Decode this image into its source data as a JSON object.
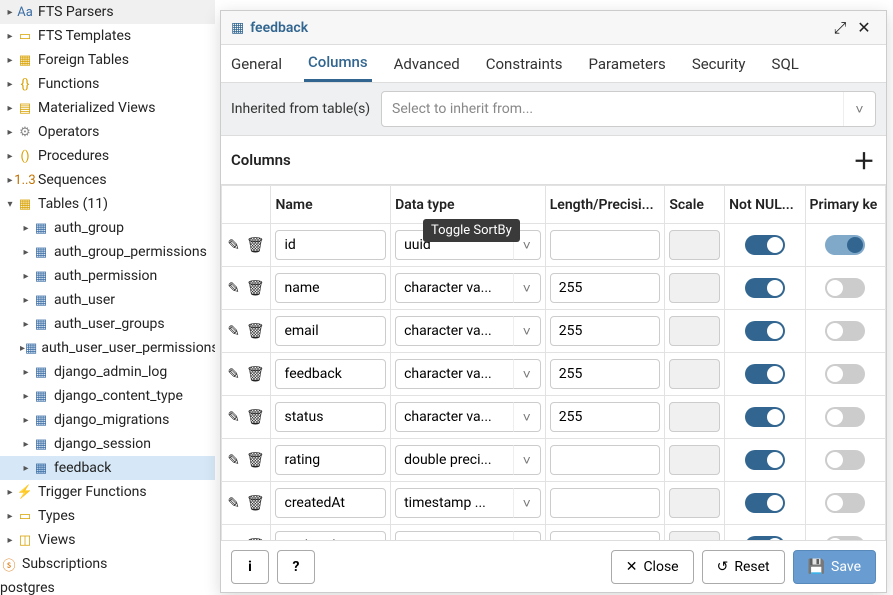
{
  "sidebar": {
    "top_items": [
      {
        "icon": "Aa",
        "label": "FTS Parsers",
        "color": "#3b6ea5"
      },
      {
        "icon": "▭",
        "label": "FTS Templates",
        "color": "#d8a100"
      },
      {
        "icon": "▦",
        "label": "Foreign Tables",
        "color": "#d8a100"
      },
      {
        "icon": "{}",
        "label": "Functions",
        "color": "#d8a100"
      },
      {
        "icon": "▤",
        "label": "Materialized Views",
        "color": "#d8a100"
      },
      {
        "icon": "⚙",
        "label": "Operators",
        "color": "#888"
      },
      {
        "icon": "()",
        "label": "Procedures",
        "color": "#d8a100"
      },
      {
        "icon": "1..3",
        "label": "Sequences",
        "color": "#c07000"
      }
    ],
    "tables_label": "Tables (11)",
    "tables": [
      "auth_group",
      "auth_group_permissions",
      "auth_permission",
      "auth_user",
      "auth_user_groups",
      "auth_user_user_permissions",
      "django_admin_log",
      "django_content_type",
      "django_migrations",
      "django_session",
      "feedback"
    ],
    "bottom_items": [
      {
        "icon": "⚡",
        "label": "Trigger Functions",
        "color": "#d8a100"
      },
      {
        "icon": "▭",
        "label": "Types",
        "color": "#d8a100"
      },
      {
        "icon": "◫",
        "label": "Views",
        "color": "#d8a100"
      }
    ],
    "subscriptions": "Subscriptions",
    "db": "postgres"
  },
  "dialog": {
    "title": "feedback",
    "tabs": [
      "General",
      "Columns",
      "Advanced",
      "Constraints",
      "Parameters",
      "Security",
      "SQL"
    ],
    "active_tab": "Columns",
    "inherit_label": "Inherited from table(s)",
    "inherit_placeholder": "Select to inherit from...",
    "section": "Columns",
    "headers": [
      "",
      "Name",
      "Data type",
      "Length/Precision",
      "Scale",
      "Not NULL?",
      "Primary key?"
    ],
    "headers_disp": [
      "",
      "Name",
      "Data type",
      "Length/Precisi...",
      "Scale",
      "Not NUL...",
      "Primary ke"
    ],
    "tooltip": "Toggle SortBy",
    "rows": [
      {
        "name": "id",
        "type": "uuid",
        "type_disp": "uuid",
        "len": "",
        "scale_ro": true,
        "nn": true,
        "pk": true
      },
      {
        "name": "name",
        "type": "character varying",
        "type_disp": "character va...",
        "len": "255",
        "scale_ro": true,
        "nn": true,
        "pk": false
      },
      {
        "name": "email",
        "type": "character varying",
        "type_disp": "character va...",
        "len": "255",
        "scale_ro": true,
        "nn": true,
        "pk": false
      },
      {
        "name": "feedback",
        "type": "character varying",
        "type_disp": "character va...",
        "len": "255",
        "scale_ro": true,
        "nn": true,
        "pk": false
      },
      {
        "name": "status",
        "type": "character varying",
        "type_disp": "character va...",
        "len": "255",
        "scale_ro": true,
        "nn": true,
        "pk": false
      },
      {
        "name": "rating",
        "type": "double precision",
        "type_disp": "double preci...",
        "len": "",
        "scale_ro": true,
        "nn": true,
        "pk": false
      },
      {
        "name": "createdAt",
        "type": "timestamp with time zone",
        "type_disp": "timestamp ...",
        "len": "",
        "scale_ro": true,
        "nn": true,
        "pk": false
      },
      {
        "name": "updatedAt",
        "type": "timestamp with time zone",
        "type_disp": "timestamp ...",
        "len": "",
        "scale_ro": true,
        "nn": true,
        "pk": false
      }
    ],
    "footer": {
      "close": "Close",
      "reset": "Reset",
      "save": "Save"
    }
  }
}
